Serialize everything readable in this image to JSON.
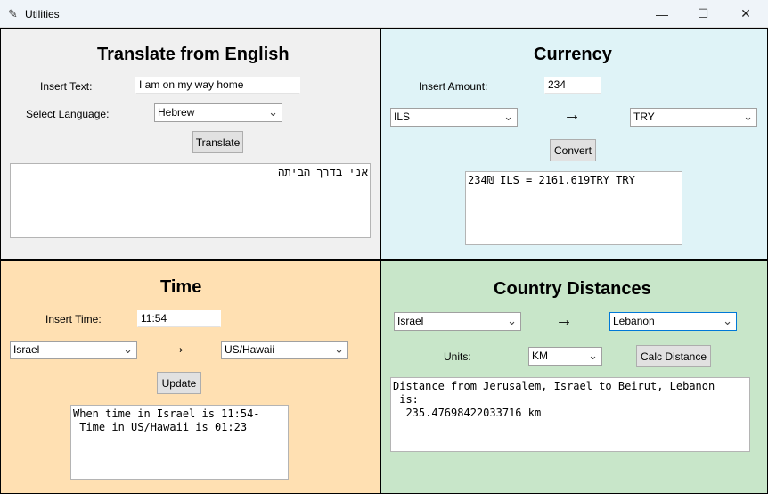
{
  "window": {
    "title": "Utilities",
    "minimize": "—",
    "maximize": "☐",
    "close": "✕"
  },
  "translate": {
    "heading": "Translate from English",
    "insert_text_label": "Insert Text:",
    "insert_text_value": "I am on my way home",
    "select_language_label": "Select Language:",
    "language_value": "Hebrew",
    "button": "Translate",
    "output": "אני בדרך הביתה"
  },
  "currency": {
    "heading": "Currency",
    "amount_label": "Insert Amount:",
    "amount_value": "234",
    "from_value": "ILS",
    "arrow": "→",
    "to_value": "TRY",
    "button": "Convert",
    "output": "234₪ ILS = 2161.619TRY TRY"
  },
  "time": {
    "heading": "Time",
    "insert_time_label": "Insert Time:",
    "insert_time_value": "11:54",
    "from_value": "Israel",
    "arrow": "→",
    "to_value": "US/Hawaii",
    "button": "Update",
    "output": "When time in Israel is 11:54-\n Time in US/Hawaii is 01:23"
  },
  "distance": {
    "heading": "Country Distances",
    "from_value": "Israel",
    "arrow": "→",
    "to_value": "Lebanon",
    "units_label": "Units:",
    "units_value": "KM",
    "button": "Calc Distance",
    "output": "Distance from Jerusalem, Israel to Beirut, Lebanon\n is:\n  235.47698422033716 km"
  },
  "icons": {
    "app": "feather-icon",
    "dropdown": "chevron-down-icon"
  }
}
